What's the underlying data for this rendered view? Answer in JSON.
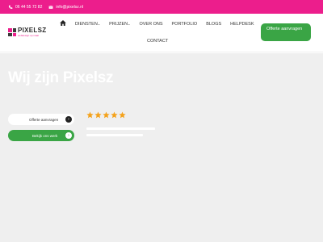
{
  "topbar": {
    "phone": "06 44 55 72 82",
    "email": "info@pixelsz.nl",
    "bg_color": "#ec1e8c"
  },
  "logo": {
    "name": "PIXELSZ",
    "tagline": "webdesign op maat"
  },
  "nav": {
    "home_icon": "home-icon",
    "items": [
      {
        "label": "Diensten",
        "has_dropdown": true
      },
      {
        "label": "Prijzen",
        "has_dropdown": true
      },
      {
        "label": "Over ons",
        "has_dropdown": false
      },
      {
        "label": "Portfolio",
        "has_dropdown": false
      },
      {
        "label": "Blogs",
        "has_dropdown": false
      },
      {
        "label": "Helpdesk",
        "has_dropdown": false
      }
    ],
    "contact": "Contact",
    "cta_label": "Offerte aanvragen",
    "cta_color": "#3aa545"
  },
  "hero": {
    "title": "Wij zijn Pixelsz",
    "offerte_button": "Offerte aanvragen",
    "werk_button": "Bekijk ons werk",
    "rating_stars": 5,
    "star_color": "#f4a21b"
  }
}
